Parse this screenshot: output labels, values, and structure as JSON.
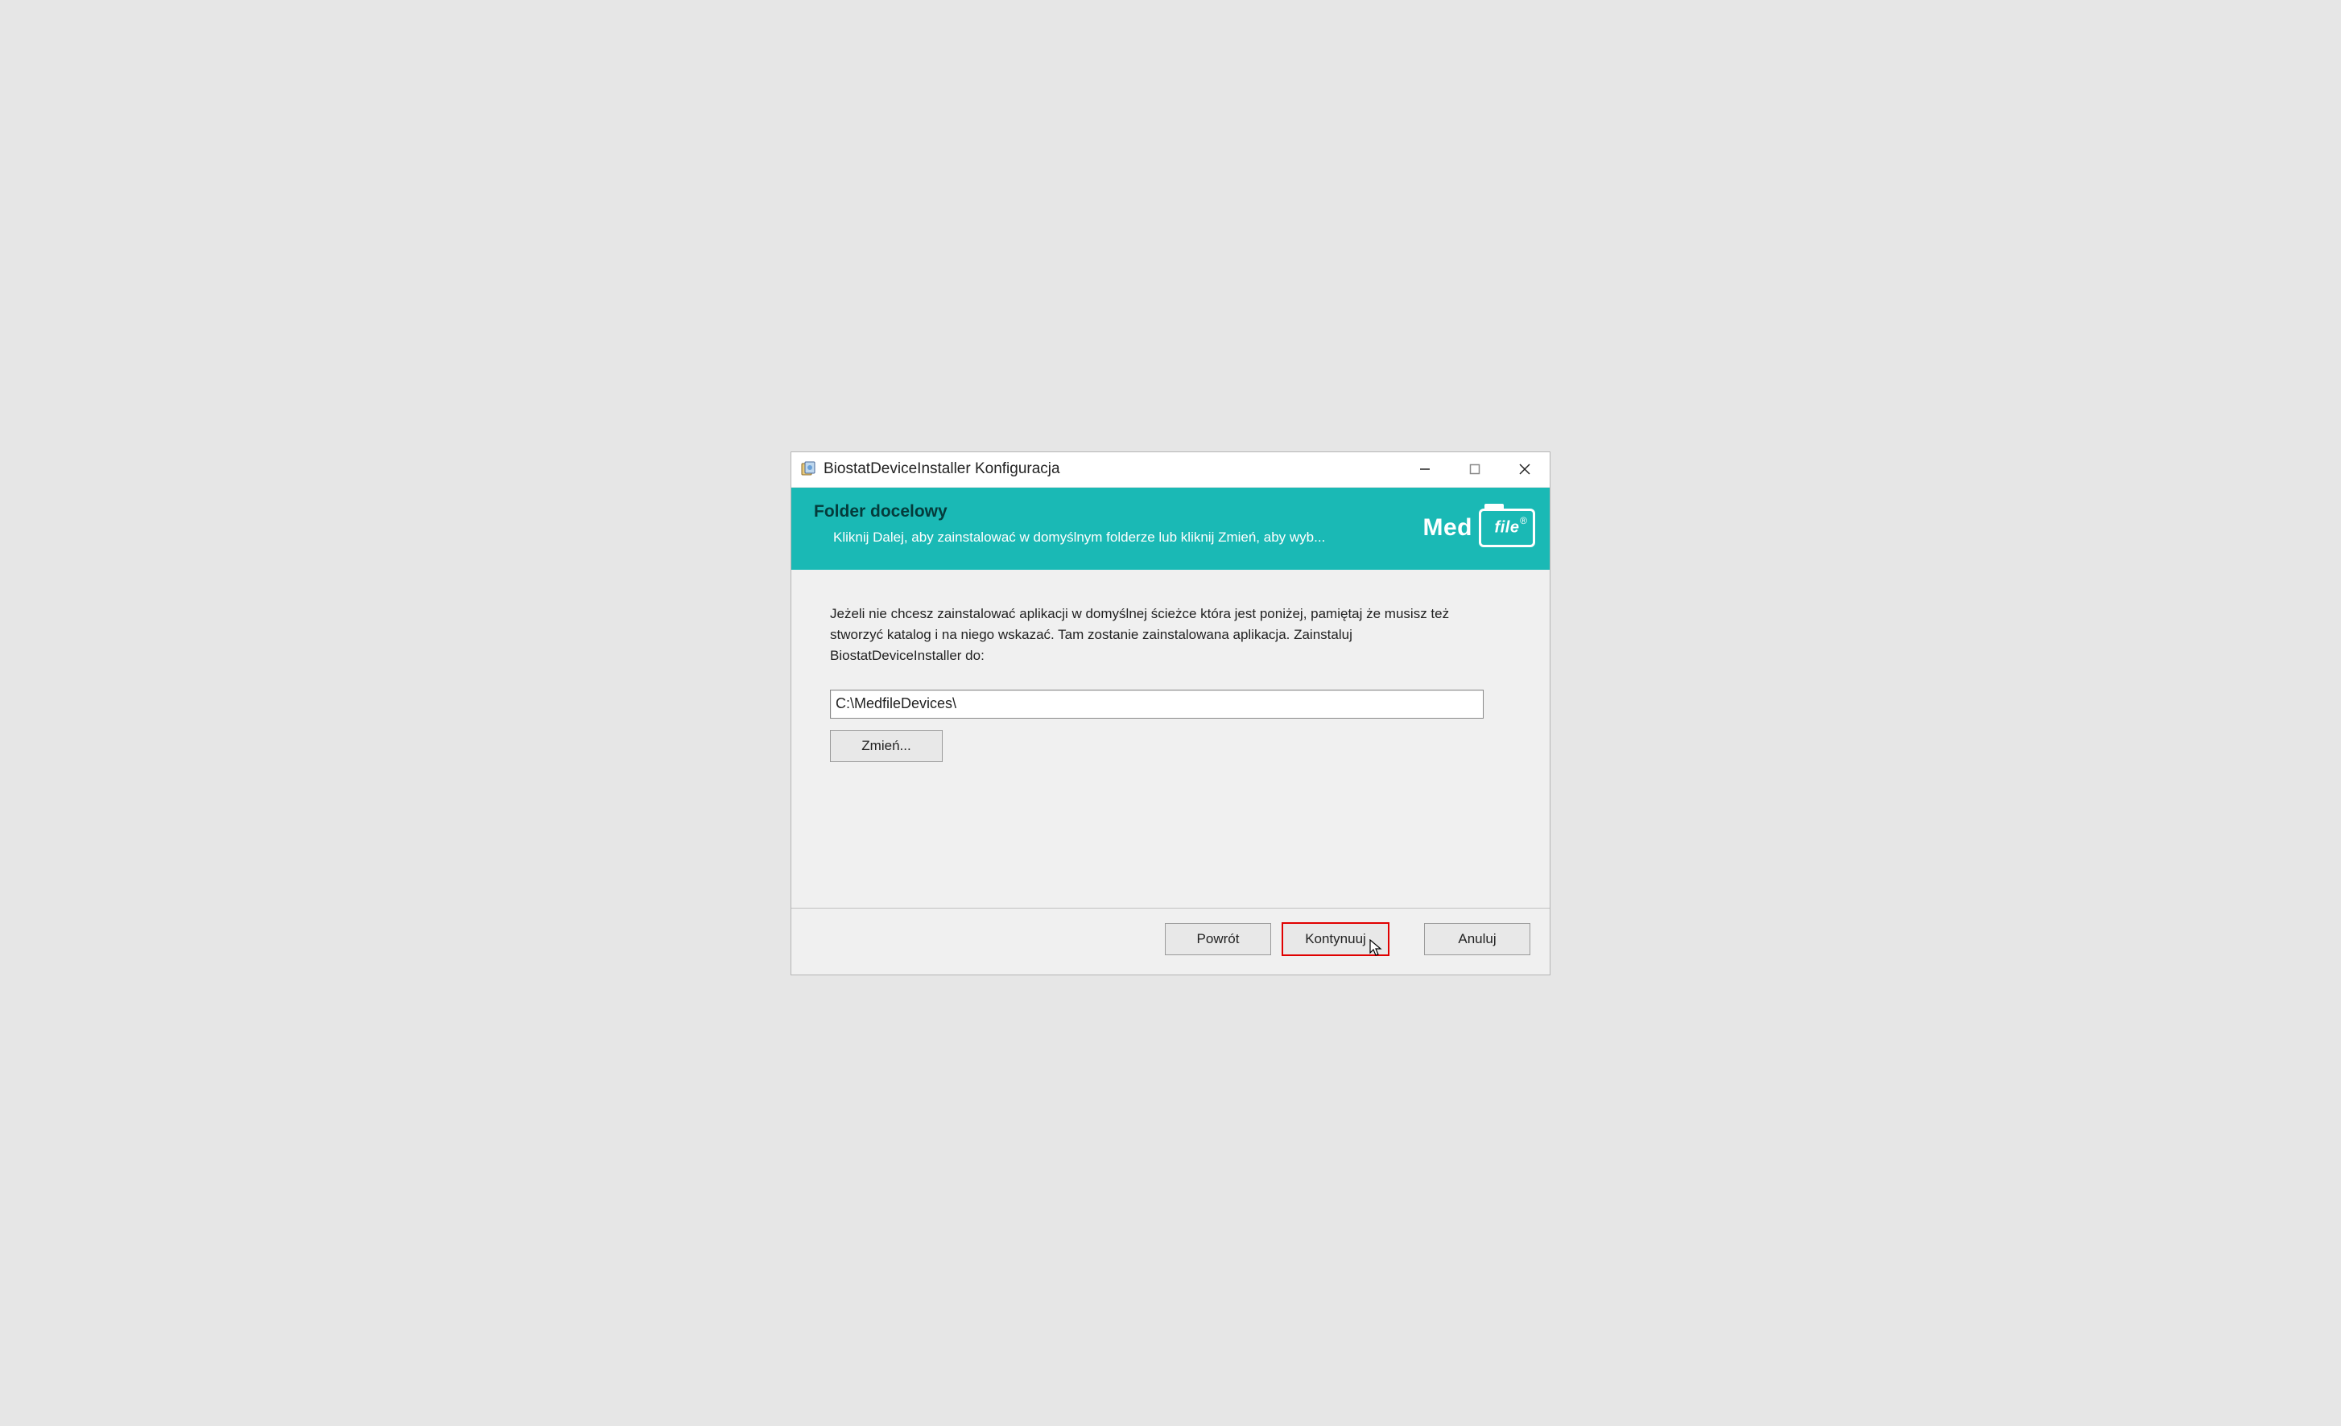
{
  "titlebar": {
    "title": "BiostatDeviceInstaller Konfiguracja"
  },
  "banner": {
    "title": "Folder docelowy",
    "subtitle": "Kliknij Dalej, aby zainstalować w domyślnym folderze lub kliknij Zmień, aby wyb..."
  },
  "logo": {
    "brand_left": "Med",
    "brand_file": "file"
  },
  "content": {
    "description": "Jeżeli nie chcesz zainstalować aplikacji w domyślnej ścieżce która jest poniżej, pamiętaj że musisz też stworzyć katalog i na niego wskazać. Tam zostanie zainstalowana aplikacja. Zainstaluj BiostatDeviceInstaller do:",
    "path": "C:\\MedfileDevices\\",
    "change_label": "Zmień..."
  },
  "footer": {
    "back": "Powrót",
    "next": "Kontynuuj",
    "cancel": "Anuluj"
  }
}
